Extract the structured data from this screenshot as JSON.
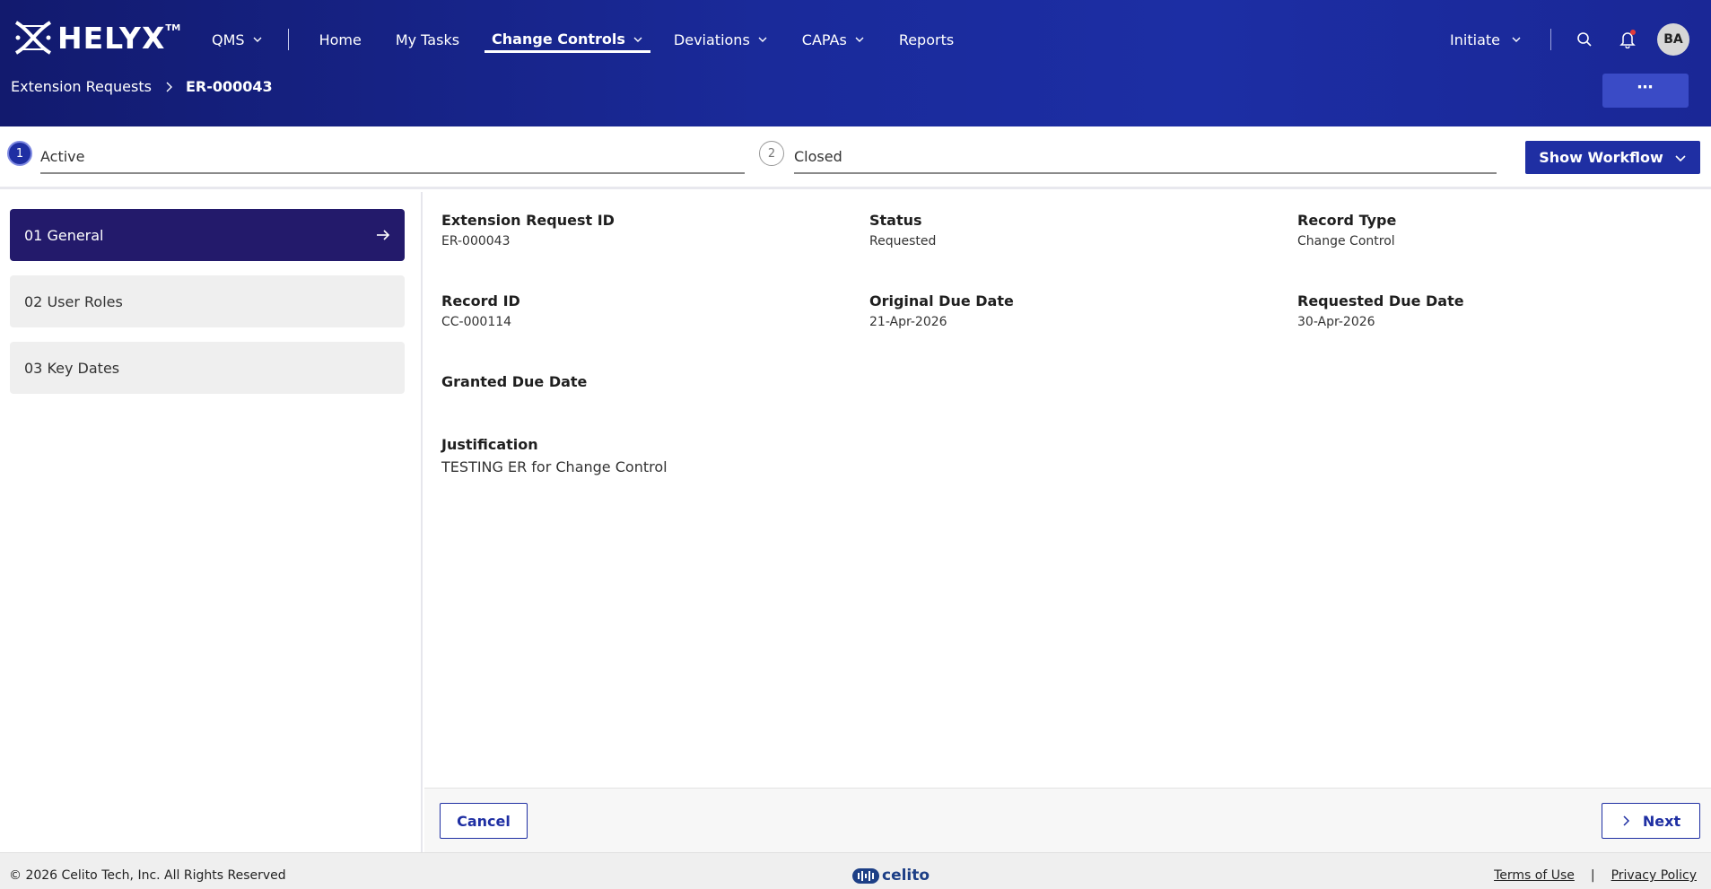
{
  "app": {
    "logo_text": "HELYX",
    "logo_tm": "TM"
  },
  "nav": {
    "items": [
      {
        "label": "QMS",
        "has_dropdown": true
      },
      {
        "label": "Home",
        "has_dropdown": false
      },
      {
        "label": "My Tasks",
        "has_dropdown": false
      },
      {
        "label": "Change Controls",
        "has_dropdown": true,
        "active": true
      },
      {
        "label": "Deviations",
        "has_dropdown": true
      },
      {
        "label": "CAPAs",
        "has_dropdown": true
      },
      {
        "label": "Reports",
        "has_dropdown": false
      }
    ],
    "initiate_label": "Initiate",
    "avatar_initials": "BA",
    "icons": [
      "search-icon",
      "bell-icon"
    ]
  },
  "breadcrumb": {
    "parent": "Extension Requests",
    "current": "ER-000043"
  },
  "more_button_label": "⋯",
  "workflow": {
    "steps": [
      {
        "number": "1",
        "label": "Active",
        "state": "active"
      },
      {
        "number": "2",
        "label": "Closed",
        "state": "inactive"
      }
    ],
    "show_workflow_label": "Show Workflow"
  },
  "sections": [
    {
      "label": "01 General",
      "active": true
    },
    {
      "label": "02 User Roles",
      "active": false
    },
    {
      "label": "03 Key Dates",
      "active": false
    }
  ],
  "fields": {
    "extension_request_id": {
      "label": "Extension Request ID",
      "value": "ER-000043"
    },
    "status": {
      "label": "Status",
      "value": "Requested"
    },
    "record_type": {
      "label": "Record Type",
      "value": "Change Control"
    },
    "record_id": {
      "label": "Record ID",
      "value": "CC-000114"
    },
    "original_due_date": {
      "label": "Original Due Date",
      "value": "21-Apr-2026"
    },
    "requested_due_date": {
      "label": "Requested Due Date",
      "value": "30-Apr-2026"
    },
    "granted_due_date": {
      "label": "Granted Due Date",
      "value": ""
    },
    "justification": {
      "label": "Justification",
      "value": "TESTING ER for Change Control"
    }
  },
  "actions": {
    "cancel_label": "Cancel",
    "next_label": "Next"
  },
  "footer": {
    "copyright": "© 2026 Celito Tech, Inc. All Rights Reserved",
    "brand": "celito",
    "terms_label": "Terms of Use",
    "separator": "|",
    "privacy_label": "Privacy Policy"
  },
  "colors": {
    "header_dark": "#121a6e",
    "header_blue": "#1c2ea4",
    "primary": "#1f2fa3",
    "section_active": "#231a6b",
    "notification_dot": "#e23b3b"
  }
}
